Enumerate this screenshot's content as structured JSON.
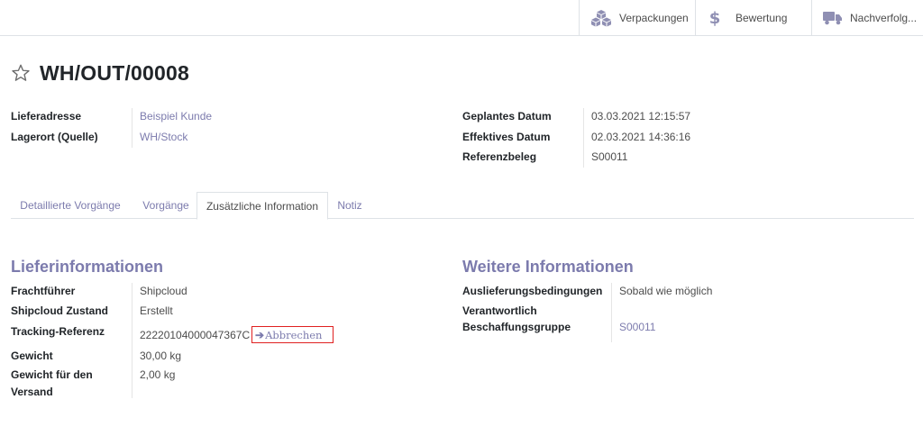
{
  "smart_buttons": [
    {
      "label": "Verpackungen",
      "icon": "cubes-icon"
    },
    {
      "label": "Bewertung",
      "icon": "dollar-icon"
    },
    {
      "label": "Nachverfolg...",
      "icon": "truck-icon"
    }
  ],
  "record": {
    "title": "WH/OUT/00008"
  },
  "left_fields": {
    "lieferadresse_label": "Lieferadresse",
    "lieferadresse_value": "Beispiel Kunde",
    "lagerort_label": "Lagerort (Quelle)",
    "lagerort_value": "WH/Stock"
  },
  "right_fields": {
    "geplantes_label": "Geplantes Datum",
    "geplantes_value": "03.03.2021 12:15:57",
    "effektives_label": "Effektives Datum",
    "effektives_value": "02.03.2021 14:36:16",
    "referenz_label": "Referenzbeleg",
    "referenz_value": "S00011"
  },
  "tabs": [
    {
      "label": "Detaillierte Vorgänge",
      "active": false
    },
    {
      "label": "Vorgänge",
      "active": false
    },
    {
      "label": "Zusätzliche Information",
      "active": true
    },
    {
      "label": "Notiz",
      "active": false
    }
  ],
  "liefer": {
    "section_title": "Lieferinformationen",
    "frachtfuehrer_label": "Frachtführer",
    "frachtfuehrer_value": "Shipcloud",
    "zustand_label": "Shipcloud Zustand",
    "zustand_value": "Erstellt",
    "tracking_label": "Tracking-Referenz",
    "tracking_value": "22220104000047367C",
    "cancel_label": "Abbrechen",
    "gewicht_label": "Gewicht",
    "gewicht_value": "30,00 kg",
    "versand_label_1": "Gewicht für den",
    "versand_label_2": "Versand",
    "versand_value": "2,00 kg"
  },
  "weitere": {
    "section_title": "Weitere Informationen",
    "bedingungen_label": "Auslieferungsbedingungen",
    "bedingungen_value": "Sobald wie möglich",
    "verantwortlich_label": "Verantwortlich",
    "gruppe_label": "Beschaffungsgruppe",
    "gruppe_value": "S00011"
  },
  "colors": {
    "accent": "#7c7bad",
    "highlight_border": "#e02020",
    "icon": "#8f8fb3"
  }
}
